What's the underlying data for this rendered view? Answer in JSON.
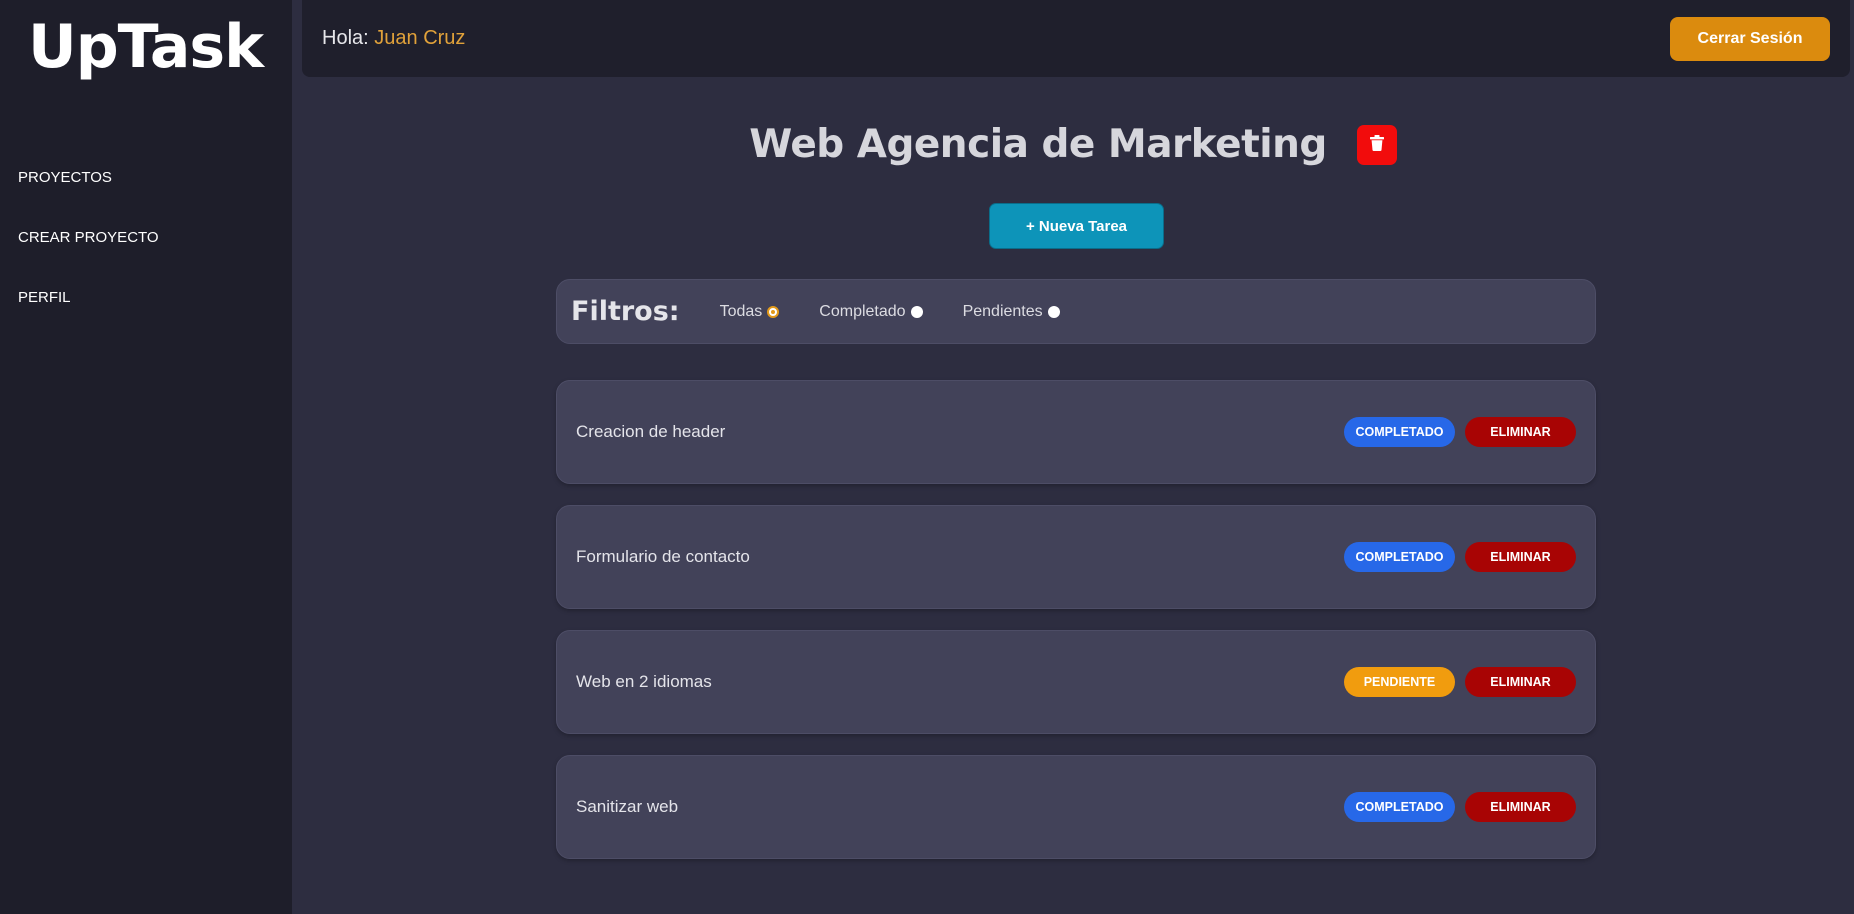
{
  "sidebar": {
    "logo": "UpTask",
    "items": [
      {
        "label": "PROYECTOS"
      },
      {
        "label": "CREAR PROYECTO"
      },
      {
        "label": "PERFIL"
      }
    ]
  },
  "header": {
    "greeting": "Hola:",
    "user_name": "Juan Cruz",
    "logout_label": "Cerrar Sesión"
  },
  "project": {
    "title": "Web Agencia de Marketing",
    "delete_icon": "trash-icon",
    "new_task_label": "+ Nueva Tarea"
  },
  "filters": {
    "label": "Filtros:",
    "options": [
      {
        "label": "Todas",
        "checked": true
      },
      {
        "label": "Completado",
        "checked": false
      },
      {
        "label": "Pendientes",
        "checked": false
      }
    ]
  },
  "tasks": [
    {
      "name": "Creacion de header",
      "status": "COMPLETADO",
      "delete_label": "ELIMINAR"
    },
    {
      "name": "Formulario de contacto",
      "status": "COMPLETADO",
      "delete_label": "ELIMINAR"
    },
    {
      "name": "Web en 2 idiomas",
      "status": "PENDIENTE",
      "delete_label": "ELIMINAR"
    },
    {
      "name": "Sanitizar web",
      "status": "COMPLETADO",
      "delete_label": "ELIMINAR"
    }
  ],
  "colors": {
    "accent": "#db8b0e",
    "completed": "#2768e8",
    "pending": "#f19c0e",
    "delete": "#a80404",
    "new_task": "#0d94b9",
    "delete_project": "#f20c0c"
  }
}
